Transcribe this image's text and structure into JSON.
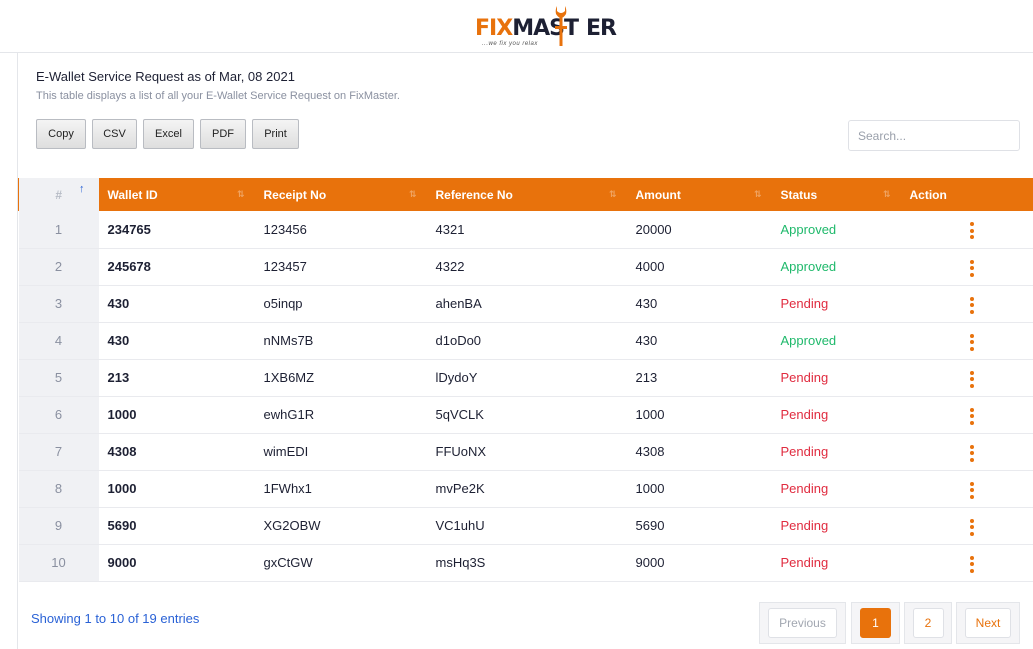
{
  "brand": {
    "name_part1": "FIX",
    "name_part2": "MAST",
    "name_part3": "ER",
    "tagline": "...we fix you relax",
    "accent_color": "#e8720c",
    "dark_color": "#1d2033"
  },
  "page": {
    "title": "E-Wallet Service Request as of Mar, 08 2021",
    "subtitle": "This table displays a list of all your E-Wallet Service Request on FixMaster."
  },
  "toolbar": {
    "copy": "Copy",
    "csv": "CSV",
    "excel": "Excel",
    "pdf": "PDF",
    "print": "Print"
  },
  "search": {
    "placeholder": "Search..."
  },
  "table": {
    "headers": {
      "index": "#",
      "wallet_id": "Wallet ID",
      "receipt_no": "Receipt No",
      "reference_no": "Reference No",
      "amount": "Amount",
      "status": "Status",
      "action": "Action"
    },
    "rows": [
      {
        "index": "1",
        "wallet_id": "234765",
        "receipt_no": "123456",
        "reference_no": "4321",
        "amount": "20000",
        "status": "Approved"
      },
      {
        "index": "2",
        "wallet_id": "245678",
        "receipt_no": "123457",
        "reference_no": "4322",
        "amount": "4000",
        "status": "Approved"
      },
      {
        "index": "3",
        "wallet_id": "430",
        "receipt_no": "o5inqp",
        "reference_no": "ahenBA",
        "amount": "430",
        "status": "Pending"
      },
      {
        "index": "4",
        "wallet_id": "430",
        "receipt_no": "nNMs7B",
        "reference_no": "d1oDo0",
        "amount": "430",
        "status": "Approved"
      },
      {
        "index": "5",
        "wallet_id": "213",
        "receipt_no": "1XB6MZ",
        "reference_no": "lDydoY",
        "amount": "213",
        "status": "Pending"
      },
      {
        "index": "6",
        "wallet_id": "1000",
        "receipt_no": "ewhG1R",
        "reference_no": "5qVCLK",
        "amount": "1000",
        "status": "Pending"
      },
      {
        "index": "7",
        "wallet_id": "4308",
        "receipt_no": "wimEDI",
        "reference_no": "FFUoNX",
        "amount": "4308",
        "status": "Pending"
      },
      {
        "index": "8",
        "wallet_id": "1000",
        "receipt_no": "1FWhx1",
        "reference_no": "mvPe2K",
        "amount": "1000",
        "status": "Pending"
      },
      {
        "index": "9",
        "wallet_id": "5690",
        "receipt_no": "XG2OBW",
        "reference_no": "VC1uhU",
        "amount": "5690",
        "status": "Pending"
      },
      {
        "index": "10",
        "wallet_id": "9000",
        "receipt_no": "gxCtGW",
        "reference_no": "msHq3S",
        "amount": "9000",
        "status": "Pending"
      }
    ],
    "status_colors": {
      "Approved": "#1fb96b",
      "Pending": "#e02b3f"
    }
  },
  "footer": {
    "info": "Showing 1 to 10 of 19 entries",
    "pagination": {
      "previous": "Previous",
      "page1": "1",
      "page2": "2",
      "next": "Next",
      "current_page": 1
    }
  }
}
